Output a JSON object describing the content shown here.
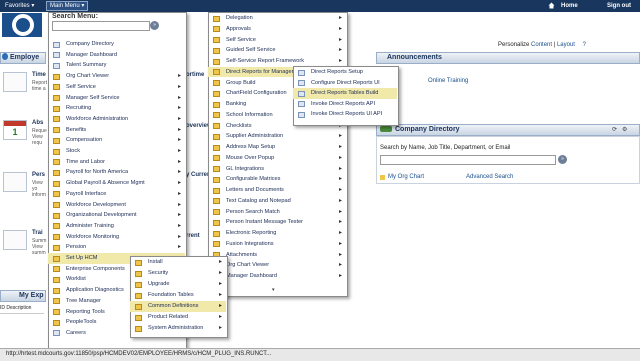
{
  "topbar": {
    "favorites": "Favorites ▾",
    "main_menu": "Main Menu ▾",
    "home": "Home",
    "signout": "Sign out"
  },
  "personalize": {
    "prefix": "Personalize",
    "content": "Content",
    "sep": " | ",
    "layout": "Layout",
    "help": "?"
  },
  "pagelets": {
    "employee": "Employe",
    "tiles": [
      {
        "title": "Time",
        "desc": "Report time a"
      },
      {
        "title": "Abs",
        "desc": "Reque View requ"
      },
      {
        "title": "Pers",
        "desc": "View yo inform"
      },
      {
        "title": "Trai",
        "desc": "Summ View summ"
      }
    ],
    "myexp": "My Exp",
    "desc_header": "ID  Description",
    "mid_fragments": [
      "ortime",
      "overview",
      "y Current",
      "rrent"
    ],
    "announcements": "Announcements",
    "ann_item": "Online Training",
    "company_directory": "Company Directory",
    "cd_label": "Search by Name, Job Title, Department, or Email",
    "cd_go": "»",
    "org_chart": "My Org Chart",
    "advanced": "Advanced Search"
  },
  "menu1": {
    "title": "Search Menu:",
    "go": "»",
    "items": [
      {
        "label": "Company Directory",
        "icon": "page",
        "sub": false
      },
      {
        "label": "Manager Dashboard",
        "icon": "page",
        "sub": false
      },
      {
        "label": "Talent Summary",
        "icon": "page",
        "sub": false
      },
      {
        "label": "Org Chart Viewer",
        "icon": "folder",
        "sub": true
      },
      {
        "label": "Self Service",
        "icon": "folder",
        "sub": true
      },
      {
        "label": "Manager Self Service",
        "icon": "folder",
        "sub": true
      },
      {
        "label": "Recruiting",
        "icon": "folder",
        "sub": true
      },
      {
        "label": "Workforce Administration",
        "icon": "folder",
        "sub": true
      },
      {
        "label": "Benefits",
        "icon": "folder",
        "sub": true
      },
      {
        "label": "Compensation",
        "icon": "folder",
        "sub": true
      },
      {
        "label": "Stock",
        "icon": "folder",
        "sub": true
      },
      {
        "label": "Time and Labor",
        "icon": "folder",
        "sub": true
      },
      {
        "label": "Payroll for North America",
        "icon": "folder",
        "sub": true
      },
      {
        "label": "Global Payroll & Absence Mgmt",
        "icon": "folder",
        "sub": true
      },
      {
        "label": "Payroll Interface",
        "icon": "folder",
        "sub": true
      },
      {
        "label": "Workforce Development",
        "icon": "folder",
        "sub": true
      },
      {
        "label": "Organizational Development",
        "icon": "folder",
        "sub": true
      },
      {
        "label": "Administer Training",
        "icon": "folder",
        "sub": true
      },
      {
        "label": "Workforce Monitoring",
        "icon": "folder",
        "sub": true
      },
      {
        "label": "Pension",
        "icon": "folder",
        "sub": true
      },
      {
        "label": "Set Up HCM",
        "icon": "folder",
        "sub": true,
        "hl": true
      },
      {
        "label": "Enterprise Components",
        "icon": "folder",
        "sub": true
      },
      {
        "label": "Worklist",
        "icon": "folder",
        "sub": true
      },
      {
        "label": "Application Diagnostics",
        "icon": "folder",
        "sub": true
      },
      {
        "label": "Tree Manager",
        "icon": "folder",
        "sub": true
      },
      {
        "label": "Reporting Tools",
        "icon": "folder",
        "sub": true
      },
      {
        "label": "PeopleTools",
        "icon": "folder",
        "sub": true
      },
      {
        "label": "Careers",
        "icon": "page",
        "sub": false
      }
    ]
  },
  "menu2": {
    "items": [
      {
        "label": "Delegation",
        "sub": true
      },
      {
        "label": "Approvals",
        "sub": true
      },
      {
        "label": "Self Service",
        "sub": true
      },
      {
        "label": "Guided Self Service",
        "sub": true
      },
      {
        "label": "Self-Service Report Framework",
        "sub": true
      },
      {
        "label": "Direct Reports for Managers",
        "sub": true,
        "hl": true
      },
      {
        "label": "Group Build",
        "sub": true
      },
      {
        "label": "ChartField Configuration",
        "sub": true
      },
      {
        "label": "Banking",
        "sub": true
      },
      {
        "label": "School Information",
        "sub": true
      },
      {
        "label": "Checklists",
        "sub": true
      },
      {
        "label": "Supplier Administration",
        "sub": true
      },
      {
        "label": "Address Map Setup",
        "sub": true
      },
      {
        "label": "Mouse Over Popup",
        "sub": true
      },
      {
        "label": "GL Integrations",
        "sub": true
      },
      {
        "label": "Configurable Matrices",
        "sub": true
      },
      {
        "label": "Letters and Documents",
        "sub": true
      },
      {
        "label": "Text Catalog and Notepad",
        "sub": true
      },
      {
        "label": "Person Search Match",
        "sub": true
      },
      {
        "label": "Person Instant Message Tester",
        "sub": true
      },
      {
        "label": "Electronic Reporting",
        "sub": true
      },
      {
        "label": "Fusion Integrations",
        "sub": true
      },
      {
        "label": "Attachments",
        "sub": true
      },
      {
        "label": "Org Chart Viewer",
        "sub": true
      },
      {
        "label": "Manager Dashboard",
        "sub": true
      }
    ],
    "more": "▾"
  },
  "menu3": {
    "items": [
      {
        "label": "Direct Reports Setup"
      },
      {
        "label": "Configure Direct Reports UI"
      },
      {
        "label": "Direct Reports Tables Build",
        "hl": true
      },
      {
        "label": "Invoke Direct Reports API"
      },
      {
        "label": "Invoke Direct Reports UI API"
      }
    ]
  },
  "menu4": {
    "items": [
      {
        "label": "Install",
        "sub": true
      },
      {
        "label": "Security",
        "sub": true
      },
      {
        "label": "Upgrade",
        "sub": true
      },
      {
        "label": "Foundation Tables",
        "sub": true
      },
      {
        "label": "Common Definitions",
        "sub": true,
        "hl": true
      },
      {
        "label": "Product Related",
        "sub": true
      },
      {
        "label": "System Administration",
        "sub": true
      }
    ]
  },
  "status": "http://hrtest.mdcourts.gov:11850/psp/HCMDEV02/EMPLOYEE/HRMS/c/HCM_PLUG_INS.RUNCT..."
}
